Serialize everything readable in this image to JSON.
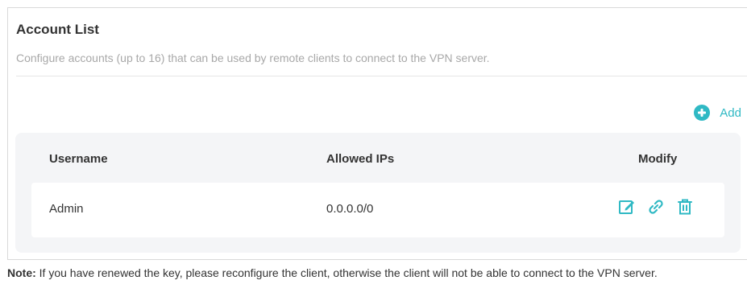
{
  "section": {
    "title": "Account List",
    "description": "Configure accounts (up to 16) that can be used by remote clients to connect to the VPN server."
  },
  "toolbar": {
    "add_label": "Add",
    "add_icon": "plus-circle-icon"
  },
  "table": {
    "columns": [
      "Username",
      "Allowed IPs",
      "Modify"
    ],
    "rows": [
      {
        "username": "Admin",
        "allowed_ips": "0.0.0.0/0",
        "actions": [
          "edit-icon",
          "link-icon",
          "delete-icon"
        ]
      }
    ]
  },
  "note": {
    "label": "Note:",
    "text": " If you have renewed the key, please reconfigure the client, otherwise the client will not be able to connect to the VPN server."
  },
  "colors": {
    "accent": "#2fb9c4",
    "table_bg": "#f4f5f7",
    "muted_text": "#a8a8a8"
  }
}
